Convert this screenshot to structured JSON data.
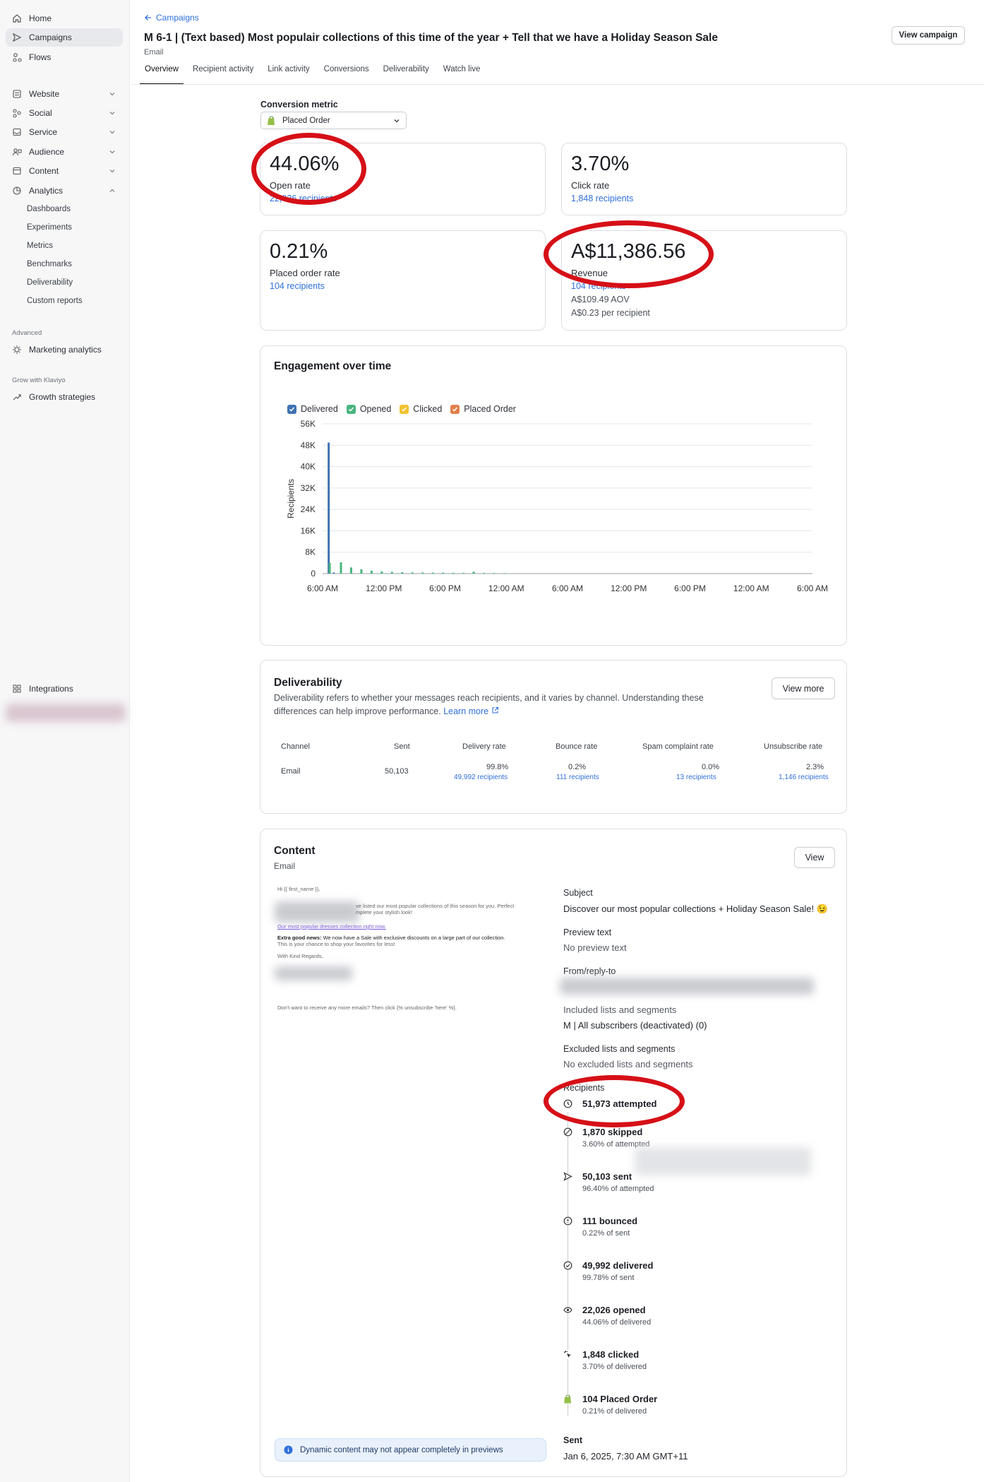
{
  "sidebar": {
    "primary": [
      {
        "label": "Home",
        "icon": "home-icon"
      },
      {
        "label": "Campaigns",
        "icon": "send-icon"
      },
      {
        "label": "Flows",
        "icon": "flows-icon"
      }
    ],
    "sections": [
      {
        "label": "Website",
        "icon": "website-icon"
      },
      {
        "label": "Social",
        "icon": "social-icon"
      },
      {
        "label": "Service",
        "icon": "service-icon"
      },
      {
        "label": "Audience",
        "icon": "audience-icon"
      },
      {
        "label": "Content",
        "icon": "content-icon"
      },
      {
        "label": "Analytics",
        "icon": "analytics-icon"
      }
    ],
    "analytics_items": [
      "Dashboards",
      "Experiments",
      "Metrics",
      "Benchmarks",
      "Deliverability",
      "Custom reports"
    ],
    "advanced_header": "Advanced",
    "marketing_analytics": "Marketing analytics",
    "grow_header": "Grow with Klaviyo",
    "growth_strategies": "Growth strategies",
    "integrations": "Integrations"
  },
  "header": {
    "back_label": "Campaigns",
    "title": "M 6-1 | (Text based) Most populair collections of this time of the year + Tell that we have a Holiday Season Sale",
    "subtitle": "Email",
    "view_campaign": "View campaign",
    "tabs": [
      "Overview",
      "Recipient activity",
      "Link activity",
      "Conversions",
      "Deliverability",
      "Watch live"
    ]
  },
  "conversion": {
    "label": "Conversion metric",
    "value": "Placed Order"
  },
  "stats": {
    "open": {
      "value": "44.06%",
      "label": "Open rate",
      "link": "22,026 recipients"
    },
    "click": {
      "value": "3.70%",
      "label": "Click rate",
      "link": "1,848 recipients"
    },
    "placed": {
      "value": "0.21%",
      "label": "Placed order rate",
      "link": "104 recipients"
    },
    "revenue": {
      "value": "A$11,386.56",
      "label": "Revenue",
      "link": "104 recipients",
      "aov": "A$109.49 AOV",
      "per": "A$0.23 per recipient"
    }
  },
  "engagement": {
    "title": "Engagement over time"
  },
  "chart_data": {
    "type": "bar",
    "title": "Engagement over time",
    "ylabel": "Recipients",
    "ylim": [
      0,
      56000
    ],
    "yticks": [
      "0",
      "8K",
      "16K",
      "24K",
      "32K",
      "40K",
      "48K",
      "56K"
    ],
    "xticks": [
      "6:00 AM",
      "12:00 PM",
      "6:00 PM",
      "12:00 AM",
      "6:00 AM",
      "12:00 PM",
      "6:00 PM",
      "12:00 AM",
      "6:00 AM"
    ],
    "x_range_hours": [
      0,
      48
    ],
    "series": [
      {
        "name": "Delivered",
        "color": "#3f72b5",
        "points": [
          [
            0.6,
            49000
          ],
          [
            1.1,
            400
          ]
        ]
      },
      {
        "name": "Opened",
        "color": "#49b57f",
        "points": [
          [
            0.7,
            4000
          ],
          [
            1.8,
            4200
          ],
          [
            2.8,
            2300
          ],
          [
            3.8,
            1600
          ],
          [
            4.8,
            1100
          ],
          [
            5.8,
            800
          ],
          [
            6.8,
            650
          ],
          [
            7.8,
            550
          ],
          [
            8.8,
            450
          ],
          [
            9.8,
            400
          ],
          [
            10.8,
            380
          ],
          [
            11.8,
            350
          ],
          [
            12.8,
            300
          ],
          [
            13.8,
            280
          ],
          [
            14.8,
            700
          ],
          [
            15.8,
            250
          ],
          [
            16.8,
            220
          ],
          [
            17.8,
            180
          ]
        ]
      },
      {
        "name": "Clicked",
        "color": "#f2c12e",
        "points": []
      },
      {
        "name": "Placed Order",
        "color": "#e2804b",
        "points": []
      }
    ],
    "grid": true,
    "legend": "top-left"
  },
  "deliverability": {
    "title": "Deliverability",
    "desc1": "Deliverability refers to whether your messages reach recipients, and it varies by channel. Understanding these",
    "desc2": "differences can help improve performance.",
    "learn_more": "Learn more",
    "view_more": "View more",
    "columns": [
      "Channel",
      "Sent",
      "Delivery rate",
      "Bounce rate",
      "Spam complaint rate",
      "Unsubscribe rate"
    ],
    "row": {
      "channel": "Email",
      "sent": "50,103",
      "delivery": "99.8%",
      "delivery_link": "49,992 recipients",
      "bounce": "0.2%",
      "bounce_link": "111 recipients",
      "spam": "0.0%",
      "spam_link": "13 recipients",
      "unsub": "2.3%",
      "unsub_link": "1,146 recipients"
    }
  },
  "content": {
    "title": "Content",
    "subtitle": "Email",
    "view": "View",
    "preview": {
      "greeting": "Hi {{ first_name }},",
      "line1": "ve listed our most popular collections of this season for you. Perfect",
      "line2": "mplete your stylish look!",
      "link": "Our most popular dresses collection right now.",
      "extra_bold": "Extra good news:",
      "extra_text": "We now have a Sale with exclusive discounts on a large part of our collection.",
      "extra_line2": "This is your chance to shop your favorites for less!",
      "regards": "With Kind Regards,",
      "unsub": "Don't want to receive any more emails? Then click {% unsubscribe 'here' %}."
    },
    "subject_label": "Subject",
    "subject": "Discover our most popular collections + Holiday Season Sale! 😉",
    "preview_label": "Preview text",
    "preview_text": "No preview text",
    "from_label": "From/reply-to",
    "included_label": "Included lists and segments",
    "included": "M | All subscribers (deactivated) (0)",
    "excluded_label": "Excluded lists and segments",
    "excluded": "No excluded lists and segments",
    "recipients_label": "Recipients",
    "timeline": [
      {
        "icon": "clock-icon",
        "value": "51,973 attempted",
        "sub": ""
      },
      {
        "icon": "skip-icon",
        "value": "1,870 skipped",
        "sub": "3.60% of attempted"
      },
      {
        "icon": "send-icon",
        "value": "50,103 sent",
        "sub": "96.40% of attempted"
      },
      {
        "icon": "alert-icon",
        "value": "111 bounced",
        "sub": "0.22% of sent"
      },
      {
        "icon": "check-circle-icon",
        "value": "49,992 delivered",
        "sub": "99.78% of sent"
      },
      {
        "icon": "eye-icon",
        "value": "22,026 opened",
        "sub": "44.06% of delivered"
      },
      {
        "icon": "click-icon",
        "value": "1,848 clicked",
        "sub": "3.70% of delivered"
      },
      {
        "icon": "shopify-icon",
        "value": "104 Placed Order",
        "sub": "0.21% of delivered"
      }
    ],
    "sent_label": "Sent",
    "sent_value": "Jan 6, 2025, 7:30 AM GMT+11",
    "notice": "Dynamic content may not appear completely in previews"
  }
}
